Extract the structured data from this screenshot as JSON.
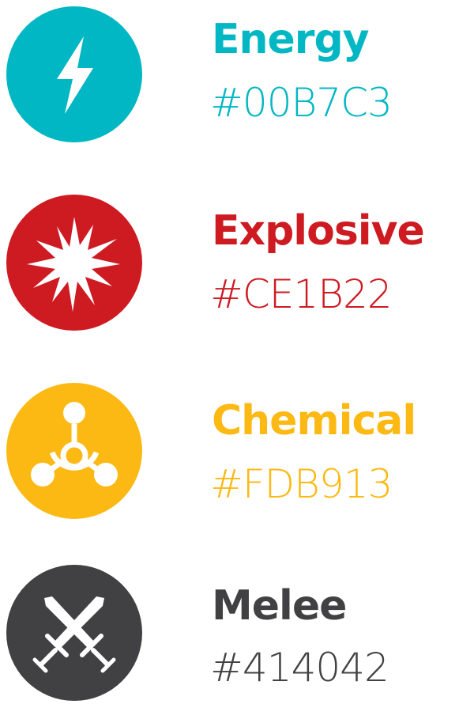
{
  "types": [
    {
      "name": "Energy",
      "hex": "#00B7C3",
      "color": "#00B7C3",
      "icon": "lightning-bolt-icon"
    },
    {
      "name": "Explosive",
      "hex": "#CE1B22",
      "color": "#CE1B22",
      "icon": "explosion-burst-icon"
    },
    {
      "name": "Chemical",
      "hex": "#FDB913",
      "color": "#FDB913",
      "icon": "molecule-icon"
    },
    {
      "name": "Melee",
      "hex": "#414042",
      "color": "#414042",
      "icon": "crossed-swords-icon"
    }
  ]
}
